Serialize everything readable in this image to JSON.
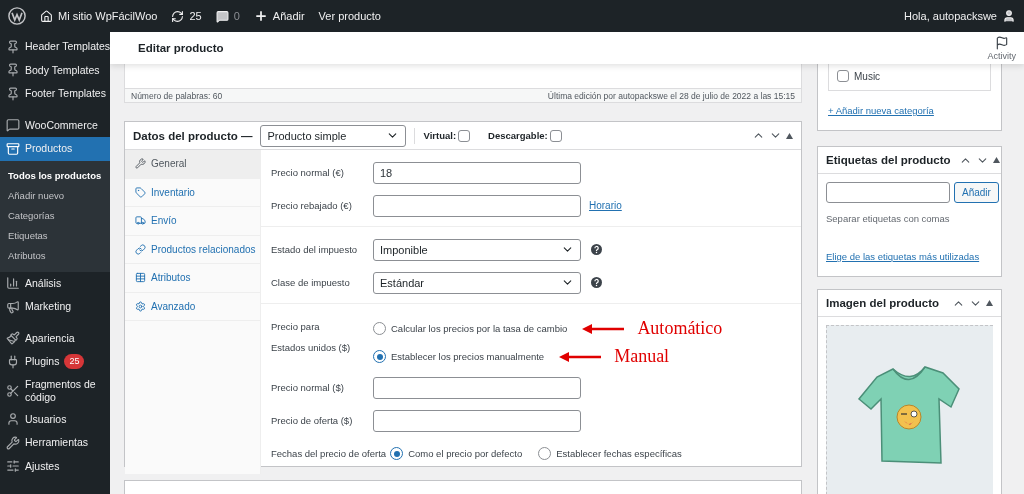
{
  "admin_bar": {
    "site": "Mi sitio WpFácilWoo",
    "updates": "25",
    "comments": "0",
    "new": "Añadir",
    "view": "Ver producto",
    "greeting": "Hola, autopackswe"
  },
  "sidebar": {
    "groups": [
      {
        "items": [
          {
            "label": "Header Templates",
            "selected": false
          },
          {
            "label": "Body Templates",
            "selected": false
          },
          {
            "label": "Footer Templates",
            "selected": false
          }
        ]
      },
      {
        "items": [
          {
            "label": "WooCommerce",
            "selected": false
          },
          {
            "label": "Productos",
            "selected": true,
            "children": [
              {
                "label": "Todos los productos",
                "selected": true
              },
              {
                "label": "Añadir nuevo",
                "selected": false
              },
              {
                "label": "Categorías",
                "selected": false
              },
              {
                "label": "Etiquetas",
                "selected": false
              },
              {
                "label": "Atributos",
                "selected": false
              }
            ]
          },
          {
            "label": "Análisis",
            "selected": false
          },
          {
            "label": "Marketing",
            "selected": false
          }
        ]
      },
      {
        "items": [
          {
            "label": "Apariencia",
            "selected": false
          },
          {
            "label": "Plugins",
            "selected": false,
            "badge": "25"
          },
          {
            "label": "Fragmentos de código",
            "selected": false
          },
          {
            "label": "Usuarios",
            "selected": false
          },
          {
            "label": "Herramientas",
            "selected": false
          },
          {
            "label": "Ajustes",
            "selected": false
          }
        ]
      }
    ]
  },
  "header": {
    "title": "Editar producto",
    "activity": "Activity"
  },
  "editor": {
    "word_count": "Número de palabras: 60",
    "last_edit": "Última edición por autopackswe el 28 de julio de 2022 a las 15:15"
  },
  "product_data": {
    "title": "Datos del producto —",
    "type": "Producto simple",
    "options": [
      {
        "label": "Virtual:",
        "checked": false
      },
      {
        "label": "Descargable:",
        "checked": false
      }
    ],
    "tabs": [
      {
        "label": "General",
        "selected": true
      },
      {
        "label": "Inventario",
        "selected": false
      },
      {
        "label": "Envío",
        "selected": false
      },
      {
        "label": "Productos relacionados",
        "selected": false
      },
      {
        "label": "Atributos",
        "selected": false
      },
      {
        "label": "Avanzado",
        "selected": false
      }
    ],
    "sections": [
      {
        "rows": [
          {
            "kind": "input",
            "label": "Precio normal (€)",
            "value": "18"
          },
          {
            "kind": "input",
            "label": "Precio rebajado (€)",
            "link": "Horario"
          }
        ]
      },
      {
        "rows": [
          {
            "kind": "select",
            "label": "Estado del impuesto",
            "value": "Imponible",
            "help": true
          },
          {
            "kind": "select",
            "label": "Clase de impuesto",
            "value": "Estándar",
            "help": true
          }
        ]
      },
      {
        "rows": [
          {
            "kind": "radio_list",
            "label_lines": [
              "Precio para",
              "Estados unidos ($)"
            ],
            "options": [
              {
                "label": "Calcular los precios por la tasa de cambio",
                "selected": false,
                "annotation": "Automático"
              },
              {
                "label": "Establecer los precios manualmente",
                "selected": true,
                "annotation": "Manual"
              }
            ]
          },
          {
            "kind": "input",
            "label": "Precio normal ($)"
          },
          {
            "kind": "input",
            "label": "Precio de oferta ($)"
          },
          {
            "kind": "radio_row",
            "label": "Fechas del precio de oferta",
            "options": [
              {
                "label": "Como el precio por defecto",
                "selected": true
              },
              {
                "label": "Establecer fechas específicas",
                "selected": false
              }
            ]
          }
        ]
      }
    ]
  },
  "categories": {
    "items": [
      {
        "label": "Music",
        "checked": false
      }
    ],
    "add_link": "+ Añadir nueva categoría"
  },
  "tags": {
    "title": "Etiquetas del producto",
    "button": "Añadir",
    "hint": "Separar etiquetas con comas",
    "link": "Elige de las etiquetas más utilizadas"
  },
  "image": {
    "title": "Imagen del producto"
  }
}
